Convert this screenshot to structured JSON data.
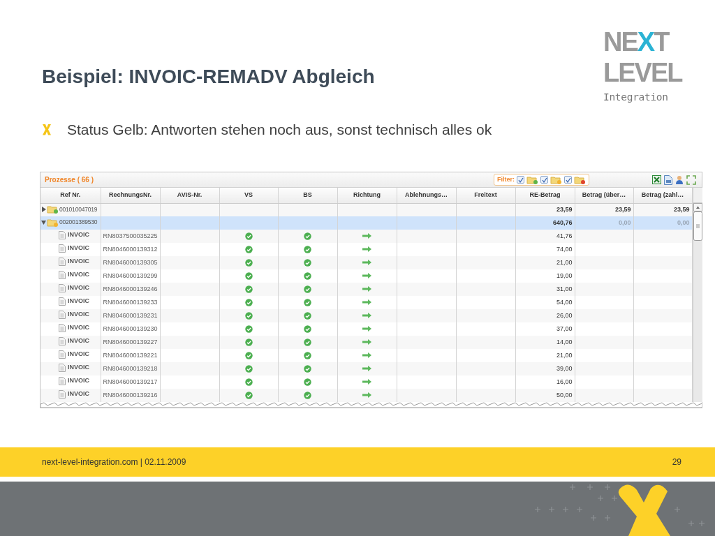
{
  "slide": {
    "title": "Beispiel: INVOIC-REMADV Abgleich",
    "logo": {
      "line1": [
        {
          "text": "NE",
          "accent": false
        },
        {
          "text": "X",
          "accent": true
        },
        {
          "text": "T",
          "accent": false
        }
      ],
      "line2": "LEVEL",
      "line3": "Integration"
    },
    "bullets": [
      "Status Gelb: Antworten stehen noch aus, sonst technisch alles ok"
    ],
    "footer": {
      "text": "next-level-integration.com | 02.11.2009",
      "page": "29"
    }
  },
  "grid": {
    "title": "Prozesse ( 66 )",
    "filter_label": "Filter:",
    "filters": [
      {
        "checked": true,
        "color": "#5fb548"
      },
      {
        "checked": true,
        "color": "#f2b431"
      },
      {
        "checked": true,
        "color": "#e0452b"
      }
    ],
    "columns": [
      "Ref Nr.",
      "RechnungsNr.",
      "AVIS-Nr.",
      "VS",
      "BS",
      "Richtung",
      "Ablehnungs…",
      "Freitext",
      "RE-Betrag",
      "Betrag (über…",
      "Betrag (zahl…"
    ],
    "rows": [
      {
        "kind": "group",
        "ref": "001010047019",
        "expanded": false,
        "selected": false,
        "color": "#5fb548",
        "re_betrag": "23,59",
        "betrag_ueber": "23,59",
        "betrag_zahl": "23,59",
        "payments_dimmed": false
      },
      {
        "kind": "group",
        "ref": "002001389530",
        "expanded": true,
        "selected": true,
        "color": "#f2b431",
        "re_betrag": "640,76",
        "betrag_ueber": "0,00",
        "betrag_zahl": "0,00",
        "payments_dimmed": true
      },
      {
        "kind": "item",
        "type": "INVOIC",
        "nr": "RN8037500035225",
        "vs_ok": true,
        "bs_ok": true,
        "outgoing": true,
        "re_betrag": "41,76",
        "selected": false
      },
      {
        "kind": "item",
        "type": "INVOIC",
        "nr": "RN8046000139312",
        "vs_ok": true,
        "bs_ok": true,
        "outgoing": true,
        "re_betrag": "74,00",
        "selected": false
      },
      {
        "kind": "item",
        "type": "INVOIC",
        "nr": "RN8046000139305",
        "vs_ok": true,
        "bs_ok": true,
        "outgoing": true,
        "re_betrag": "21,00",
        "selected": false
      },
      {
        "kind": "item",
        "type": "INVOIC",
        "nr": "RN8046000139299",
        "vs_ok": true,
        "bs_ok": true,
        "outgoing": true,
        "re_betrag": "19,00",
        "selected": false
      },
      {
        "kind": "item",
        "type": "INVOIC",
        "nr": "RN8046000139246",
        "vs_ok": true,
        "bs_ok": true,
        "outgoing": true,
        "re_betrag": "31,00",
        "selected": false
      },
      {
        "kind": "item",
        "type": "INVOIC",
        "nr": "RN8046000139233",
        "vs_ok": true,
        "bs_ok": true,
        "outgoing": true,
        "re_betrag": "54,00",
        "selected": false
      },
      {
        "kind": "item",
        "type": "INVOIC",
        "nr": "RN8046000139231",
        "vs_ok": true,
        "bs_ok": true,
        "outgoing": true,
        "re_betrag": "26,00",
        "selected": false
      },
      {
        "kind": "item",
        "type": "INVOIC",
        "nr": "RN8046000139230",
        "vs_ok": true,
        "bs_ok": true,
        "outgoing": true,
        "re_betrag": "37,00",
        "selected": false
      },
      {
        "kind": "item",
        "type": "INVOIC",
        "nr": "RN8046000139227",
        "vs_ok": true,
        "bs_ok": true,
        "outgoing": true,
        "re_betrag": "14,00",
        "selected": false
      },
      {
        "kind": "item",
        "type": "INVOIC",
        "nr": "RN8046000139221",
        "vs_ok": true,
        "bs_ok": true,
        "outgoing": true,
        "re_betrag": "21,00",
        "selected": false
      },
      {
        "kind": "item",
        "type": "INVOIC",
        "nr": "RN8046000139218",
        "vs_ok": true,
        "bs_ok": true,
        "outgoing": true,
        "re_betrag": "39,00",
        "selected": false
      },
      {
        "kind": "item",
        "type": "INVOIC",
        "nr": "RN8046000139217",
        "vs_ok": true,
        "bs_ok": true,
        "outgoing": true,
        "re_betrag": "16,00",
        "selected": false
      },
      {
        "kind": "item",
        "type": "INVOIC",
        "nr": "RN8046000139216",
        "vs_ok": true,
        "bs_ok": true,
        "outgoing": true,
        "re_betrag": "50,00",
        "selected": false
      }
    ]
  }
}
